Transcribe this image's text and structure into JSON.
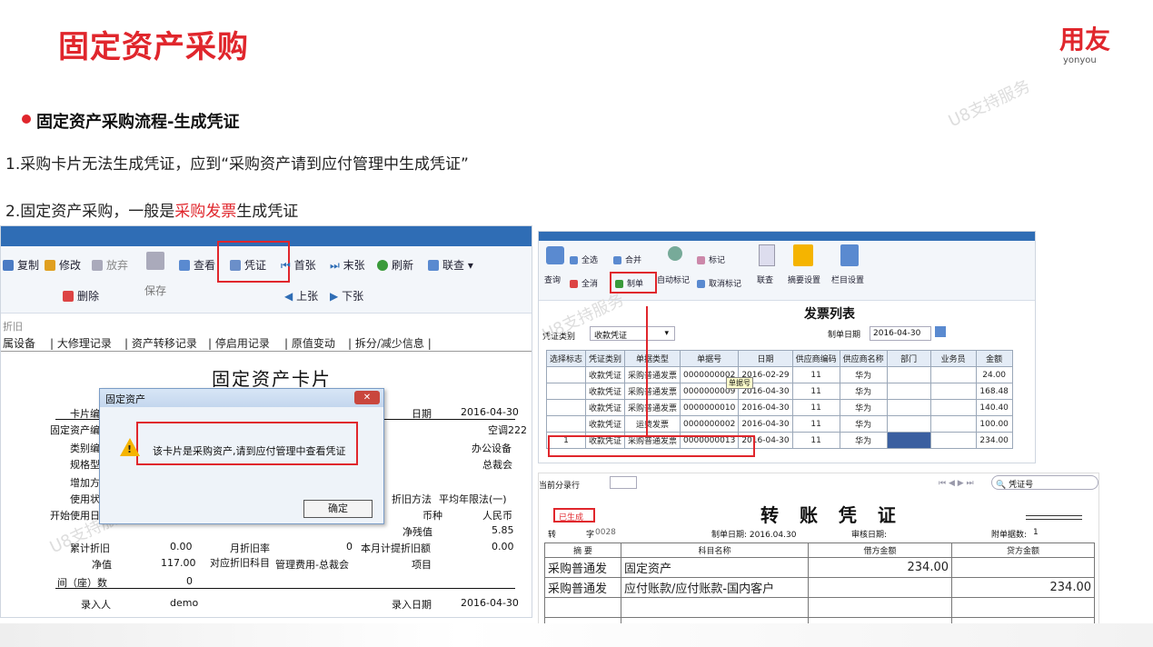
{
  "header": {
    "title": "固定资产采购",
    "logo": "用友",
    "logo_sub": "yonyou"
  },
  "section": {
    "heading": "固定资产采购流程-生成凭证"
  },
  "lines": {
    "l1": "1.采购卡片无法生成凭证，应到“采购资产请到应付管理中生成凭证”",
    "l2_pre": "2.固定资产采购，一般是",
    "l2_red": "采购发票",
    "l2_post": "生成凭证"
  },
  "watermark": "U8支持服务",
  "left": {
    "toolbar": {
      "copy": "复制",
      "edit": "修改",
      "abandon": "放弃",
      "save": "保存",
      "delete": "删除",
      "view": "查看",
      "voucher": "凭证",
      "first": "首张",
      "last": "末张",
      "refresh": "刷新",
      "link": "联查",
      "prev": "上张",
      "next": "下张"
    },
    "subtitle": "折旧",
    "tabs": [
      "属设备",
      "大修理记录",
      "资产转移记录",
      "停启用记录",
      "原值变动",
      "拆分/减少信息"
    ],
    "card_title": "固定资产卡片",
    "fields": {
      "card_no": "卡片编",
      "date_label": "日期",
      "date_value": "2016-04-30",
      "asset_no": "固定资产编",
      "name_value": "空调222",
      "category": "类别编",
      "dept_value": "办公设备",
      "spec": "规格型",
      "other_value": "总裁会",
      "add_method": "增加方",
      "use": "使用状",
      "depr_method_label": "折旧方法",
      "depr_method_value": "平均年限法(一)",
      "start_use": "开始使用日",
      "currency_label": "币种",
      "currency_value": "人民币",
      "net_label": "净残值",
      "net_value": "5.85",
      "accum_label": "累计折旧",
      "accum_value": "0.00",
      "rate_label": "月折旧率",
      "rate_value": "0",
      "month_label": "本月计提折旧额",
      "month_value": "0.00",
      "netv_label": "净值",
      "netv_value": "117.00",
      "subject_label": "对应折旧科目",
      "subject_value": "管理费用-总裁会",
      "project_label": "项目",
      "work_label": "间（座）数",
      "work_value": "0",
      "entry_label": "录入人",
      "entry_value": "demo",
      "entry_date_label": "录入日期",
      "entry_date_value": "2016-04-30"
    },
    "dialog": {
      "title": "固定资产",
      "message": "该卡片是采购资产,请到应付管理中查看凭证",
      "ok": "确定"
    }
  },
  "right": {
    "toolbar": {
      "query": "查询",
      "select_all": "全选",
      "merge": "合并",
      "clear": "全消",
      "make": "制单",
      "auto_mark": "自动标记",
      "mark": "标记",
      "cancel_mark": "取消标记",
      "link": "联查",
      "summary": "摘要设置",
      "column": "栏目设置"
    },
    "title": "发票列表",
    "vtype_label": "凭证类别",
    "vtype_value": "收款凭证",
    "date_label": "制单日期",
    "date_value": "2016-04-30",
    "tooltip": "单据号",
    "columns": [
      "选择标志",
      "凭证类别",
      "单据类型",
      "单据号",
      "日期",
      "供应商编码",
      "供应商名称",
      "部门",
      "业务员",
      "金额"
    ],
    "rows": [
      [
        "",
        "收款凭证",
        "采购普通发票",
        "0000000002",
        "2016-02-29",
        "11",
        "华为",
        "",
        "",
        "24.00"
      ],
      [
        "",
        "收款凭证",
        "采购普通发票",
        "0000000009",
        "2016-04-30",
        "11",
        "华为",
        "",
        "",
        "168.48"
      ],
      [
        "",
        "收款凭证",
        "采购普通发票",
        "0000000010",
        "2016-04-30",
        "11",
        "华为",
        "",
        "",
        "140.40"
      ],
      [
        "",
        "收款凭证",
        "运费发票",
        "0000000002",
        "2016-04-30",
        "11",
        "华为",
        "",
        "",
        "100.00"
      ],
      [
        "1",
        "收款凭证",
        "采购普通发票",
        "0000000013",
        "2016-04-30",
        "11",
        "华为",
        "",
        "",
        "234.00"
      ]
    ]
  },
  "voucher": {
    "row_label": "当前分录行",
    "search": "凭证号",
    "status": "已生成",
    "title": "转 账 凭 证",
    "type": "转",
    "no_label": "字",
    "no": "0028",
    "make_date": "制单日期: 2016.04.30",
    "audit_date": "审核日期:",
    "attach": "附单据数:",
    "attach_num": "1",
    "headers": [
      "摘 要",
      "科目名称",
      "借方金额",
      "贷方金额"
    ],
    "rows": [
      [
        "采购普通发",
        "固定资产",
        "234.00",
        ""
      ],
      [
        "采购普通发",
        "应付账款/应付账款-国内客户",
        "",
        "234.00"
      ]
    ]
  }
}
